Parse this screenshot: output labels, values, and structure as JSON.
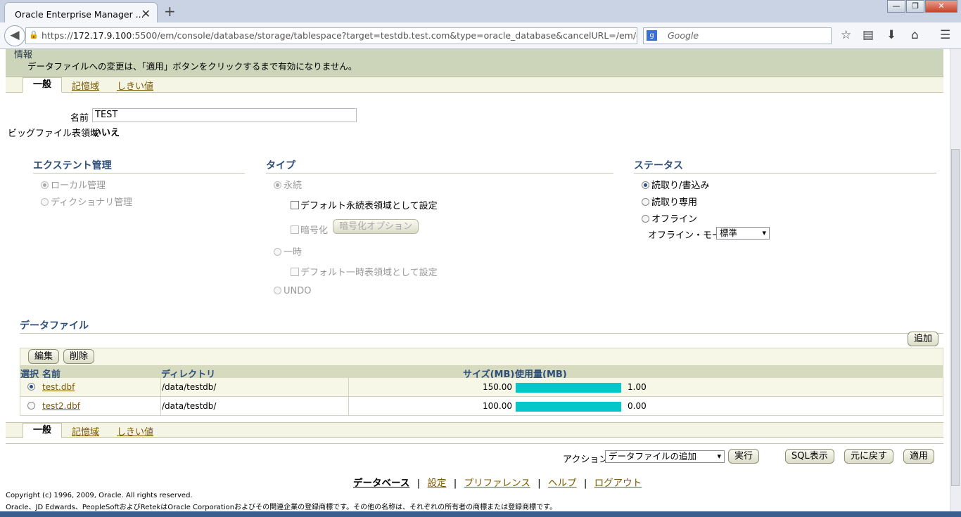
{
  "browser": {
    "tab_title": "Oracle Enterprise Manager ...",
    "close_tab": "✕",
    "new_tab": "+",
    "url_host": "172.17.9.100",
    "url_prefix": "https://",
    "url_rest": ":5500/em/console/database/storage/tablespace?target=testdb.test.com&type=oracle_database&cancelURL=/em/cc",
    "search_engine": "Google",
    "search_placeholder": "Google",
    "min": "—",
    "max": "❐",
    "close": "✕"
  },
  "info": {
    "heading": "情報",
    "text": "データファイルへの変更は、「適用」ボタンをクリックするまで有効になりません。"
  },
  "tabs": {
    "general": "一般",
    "storage": "記憶域",
    "thresholds": "しきい値"
  },
  "form": {
    "name_label": "名前",
    "name_value": "TEST",
    "bigfile_label": "ビッグファイル表領域",
    "bigfile_value": "いいえ"
  },
  "extent": {
    "title": "エクステント管理",
    "local": "ローカル管理",
    "dictionary": "ディクショナリ管理"
  },
  "type": {
    "title": "タイプ",
    "permanent": "永続",
    "default_permanent": "デフォルト永続表領域として設定",
    "encrypt": "暗号化",
    "encrypt_button": "暗号化オプション",
    "temporary": "一時",
    "default_temporary": "デフォルト一時表領域として設定",
    "undo": "UNDO"
  },
  "status": {
    "title": "ステータス",
    "read_write": "読取り/書込み",
    "read_only": "読取り専用",
    "offline": "オフライン",
    "offline_mode_label": "オフライン・モード",
    "offline_mode_value": "標準"
  },
  "datafiles": {
    "title": "データファイル",
    "add": "追加",
    "edit": "編集",
    "delete": "削除",
    "columns": {
      "select": "選択",
      "name": "名前",
      "directory": "ディレクトリ",
      "size": "サイズ(MB)",
      "used": "使用量(MB)"
    },
    "rows": [
      {
        "name": "test.dbf",
        "directory": "/data/testdb/",
        "size": "150.00",
        "used": "1.00",
        "selected": true
      },
      {
        "name": "test2.dbf",
        "directory": "/data/testdb/",
        "size": "100.00",
        "used": "0.00",
        "selected": false
      }
    ]
  },
  "actions": {
    "label": "アクション",
    "select_value": "データファイルの追加",
    "go": "実行",
    "show_sql": "SQL表示",
    "revert": "元に戻す",
    "apply": "適用"
  },
  "footer": {
    "database": "データベース",
    "setup": "設定",
    "preferences": "プリファレンス",
    "help": "ヘルプ",
    "logout": "ログアウト",
    "sep": "|",
    "copyright": "Copyright (c) 1996, 2009, Oracle. All rights reserved.",
    "trademark": "Oracle、JD Edwards、PeopleSoftおよびRetekはOracle Corporationおよびその関連企業の登録商標です。その他の名称は、それぞれの所有者の商標または登録商標です。"
  }
}
